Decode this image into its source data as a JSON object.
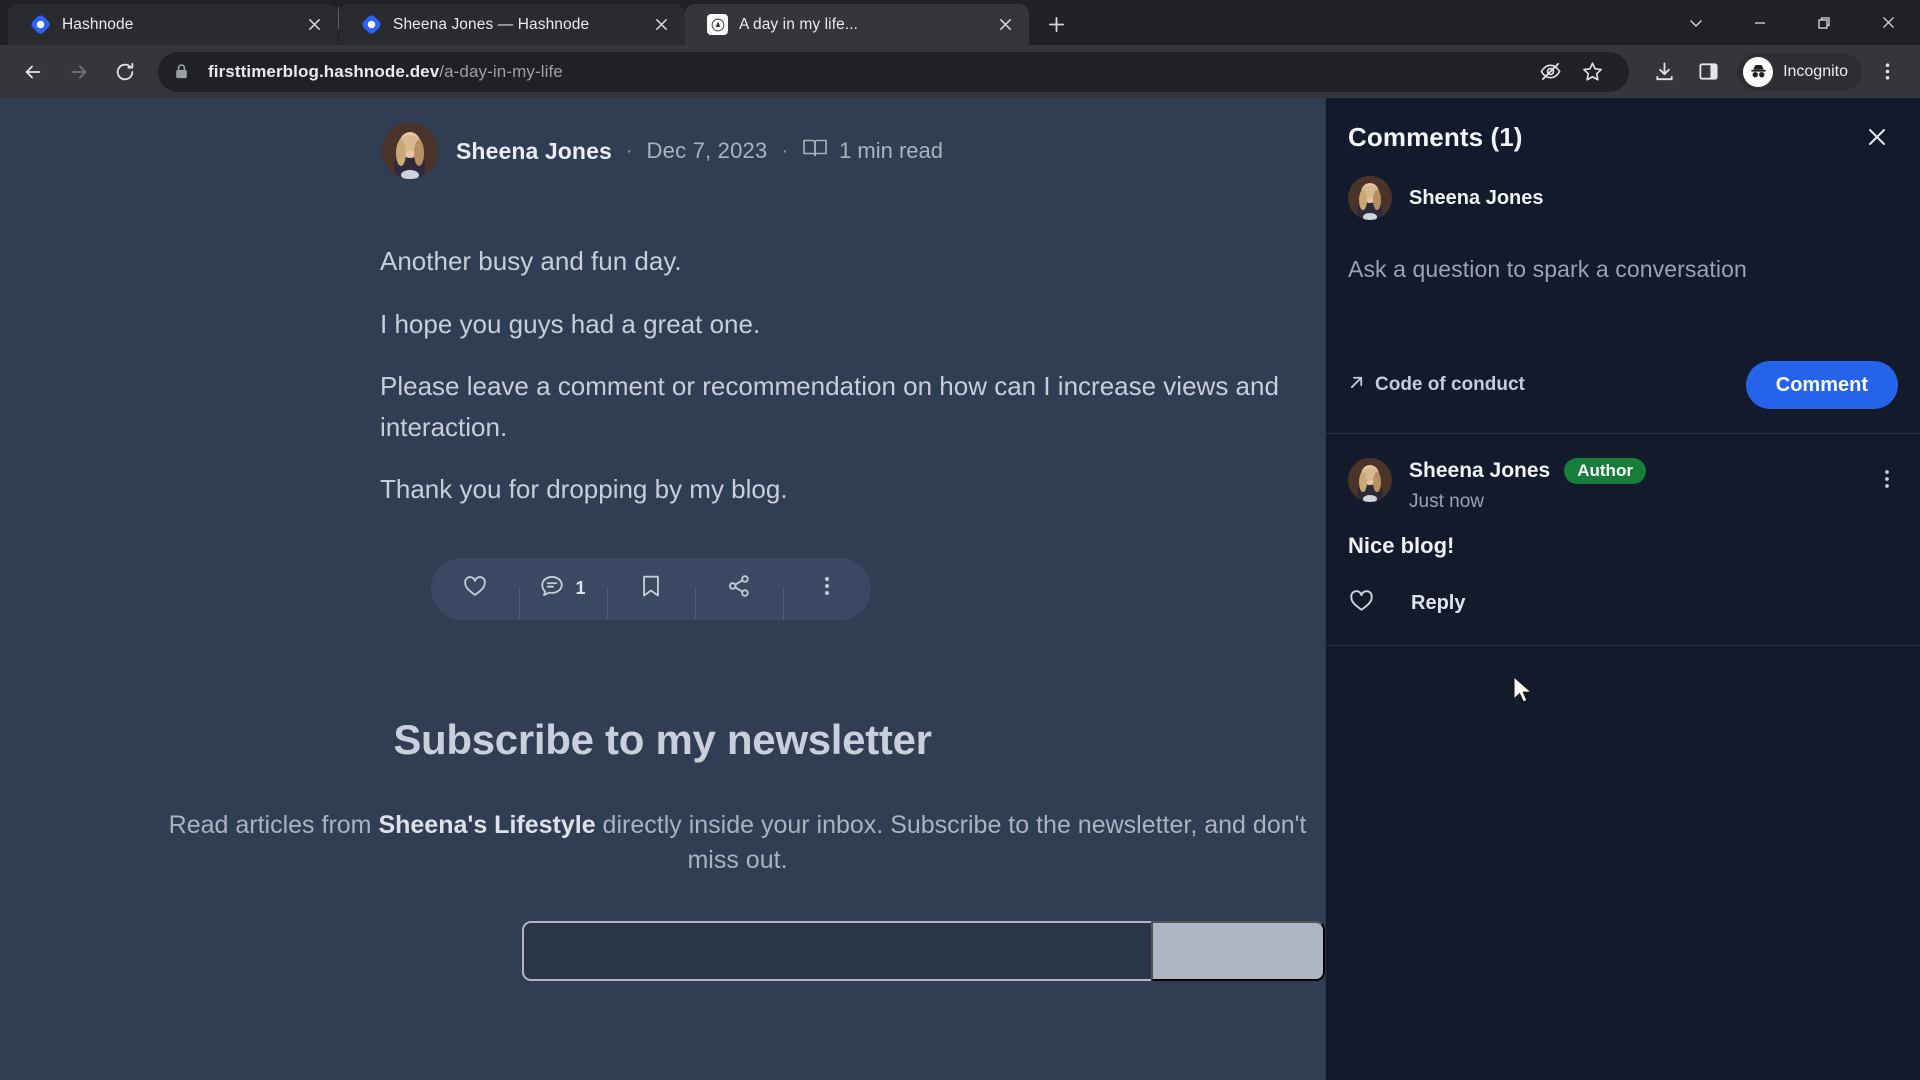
{
  "browser": {
    "tabs": [
      {
        "title": "Hashnode",
        "favicon": "hashnode-logo-icon",
        "active": false
      },
      {
        "title": "Sheena Jones — Hashnode",
        "favicon": "hashnode-logo-icon",
        "active": false
      },
      {
        "title": "A day in my life...",
        "favicon": "blog-site-icon",
        "active": true
      }
    ],
    "new_tab_label": "+",
    "window_controls": [
      "tab-search-chevron-icon",
      "minimize-icon",
      "restore-icon",
      "close-icon"
    ],
    "nav": {
      "back_icon": "back-arrow-icon",
      "forward_icon": "forward-arrow-icon",
      "reload_icon": "reload-icon"
    },
    "omnibox": {
      "lock_icon": "lock-icon",
      "url_domain": "firsttimerblog.hashnode.dev",
      "url_path": "/a-day-in-my-life",
      "tracker_icon": "eye-crossed-icon",
      "bookmark_icon": "star-icon"
    },
    "toolbar_icons": [
      "download-icon",
      "side-panel-icon"
    ],
    "profile": {
      "label": "Incognito",
      "icon": "incognito-icon"
    },
    "menu_icon": "three-dot-menu-icon"
  },
  "article": {
    "author": "Sheena Jones",
    "separator": "·",
    "date": "Dec 7, 2023",
    "read_time": "1 min read",
    "read_icon": "book-icon",
    "paragraphs": [
      "Another busy and fun day.",
      "I hope you guys had a great one.",
      "Please leave a comment or recommendation on how can I increase views and interaction.",
      "Thank you for dropping by my blog."
    ],
    "actions": {
      "like_icon": "heart-icon",
      "comment_icon": "comment-bubble-icon",
      "comment_count": "1",
      "bookmark_icon": "bookmark-icon",
      "share_icon": "share-icon",
      "more_icon": "three-dot-menu-icon"
    }
  },
  "newsletter": {
    "title": "Subscribe to my newsletter",
    "description_pre": "Read articles from ",
    "description_brand": "Sheena's Lifestyle",
    "description_post": " directly inside your inbox. Subscribe to the newsletter, and don't miss out.",
    "email_value": "",
    "email_placeholder": "",
    "subscribe_label": ""
  },
  "comments_panel": {
    "title": "Comments (1)",
    "close_icon": "close-icon",
    "composer": {
      "user_name": "Sheena Jones",
      "placeholder": "Ask a question to spark a conversation",
      "value": "",
      "code_of_conduct": "Code of conduct",
      "code_of_conduct_icon": "external-link-arrow-icon",
      "submit_label": "Comment",
      "submit_color": "#2563eb"
    },
    "items": [
      {
        "name": "Sheena Jones",
        "badge": "Author",
        "badge_color": "#167d3a",
        "time": "Just now",
        "text": "Nice blog!",
        "like_icon": "heart-icon",
        "reply_label": "Reply",
        "more_icon": "three-dot-menu-icon"
      }
    ]
  }
}
